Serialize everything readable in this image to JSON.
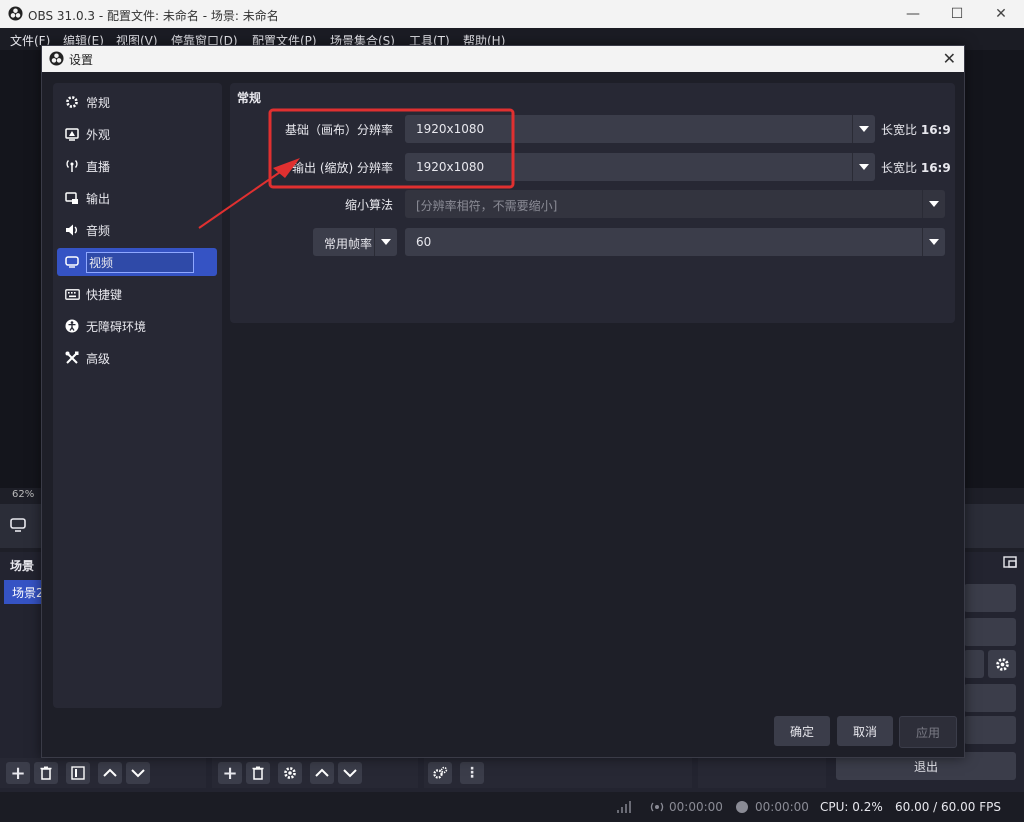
{
  "window": {
    "title": "OBS 31.0.3 - 配置文件: 未命名 - 场景: 未命名"
  },
  "menu": [
    "文件(F)",
    "编辑(E)",
    "视图(V)",
    "停靠窗口(D)",
    "配置文件(P)",
    "场景集合(S)",
    "工具(T)",
    "帮助(H)"
  ],
  "main": {
    "zoom": "62%",
    "scenes_title": "场景",
    "scene_item": "场景2",
    "exit_label": "退出"
  },
  "status": {
    "rec_time": "00:00:00",
    "stream_time": "00:00:00",
    "cpu": "CPU: 0.2%",
    "fps": "60.00 / 60.00 FPS"
  },
  "dialog": {
    "title": "设置",
    "sidebar": [
      {
        "label": "常规",
        "icon": "gear-icon"
      },
      {
        "label": "外观",
        "icon": "appearance-icon"
      },
      {
        "label": "直播",
        "icon": "antenna-icon"
      },
      {
        "label": "输出",
        "icon": "output-icon"
      },
      {
        "label": "音频",
        "icon": "speaker-icon"
      },
      {
        "label": "视频",
        "icon": "monitor-icon",
        "active": true
      },
      {
        "label": "快捷键",
        "icon": "keyboard-icon"
      },
      {
        "label": "无障碍环境",
        "icon": "accessibility-icon"
      },
      {
        "label": "高级",
        "icon": "tools-icon"
      }
    ],
    "panel_title": "常规",
    "base_resolution": {
      "label": "基础（画布）分辨率",
      "value": "1920x1080",
      "ratio_label": "长宽比",
      "ratio": "16:9"
    },
    "output_resolution": {
      "label": "输出 (缩放) 分辨率",
      "value": "1920x1080",
      "ratio_label": "长宽比",
      "ratio": "16:9"
    },
    "downscale": {
      "label": "缩小算法",
      "value": "[分辨率相符，不需要缩小]"
    },
    "fps": {
      "type_label": "常用帧率",
      "value": "60"
    },
    "buttons": {
      "ok": "确定",
      "cancel": "取消",
      "apply": "应用"
    },
    "highlight_color": "#e03030"
  }
}
